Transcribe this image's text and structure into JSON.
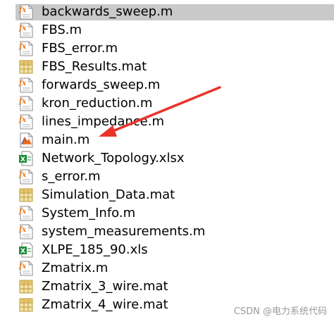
{
  "files": [
    {
      "name": "backwards_sweep.m",
      "icon": "matlab-function-icon",
      "selected": true
    },
    {
      "name": "FBS.m",
      "icon": "matlab-function-icon"
    },
    {
      "name": "FBS_error.m",
      "icon": "matlab-function-icon"
    },
    {
      "name": "FBS_Results.mat",
      "icon": "mat-data-file-icon"
    },
    {
      "name": "forwards_sweep.m",
      "icon": "matlab-function-icon"
    },
    {
      "name": "kron_reduction.m",
      "icon": "matlab-function-icon"
    },
    {
      "name": "lines_impedance.m",
      "icon": "matlab-function-icon"
    },
    {
      "name": "main.m",
      "icon": "matlab-script-icon"
    },
    {
      "name": "Network_Topology.xlsx",
      "icon": "excel-file-icon"
    },
    {
      "name": "s_error.m",
      "icon": "matlab-function-icon"
    },
    {
      "name": "Simulation_Data.mat",
      "icon": "mat-data-file-icon"
    },
    {
      "name": "System_Info.m",
      "icon": "matlab-function-icon"
    },
    {
      "name": "system_measurements.m",
      "icon": "matlab-function-icon"
    },
    {
      "name": "XLPE_185_90.xls",
      "icon": "excel-file-icon"
    },
    {
      "name": "Zmatrix.m",
      "icon": "matlab-function-icon"
    },
    {
      "name": "Zmatrix_3_wire.mat",
      "icon": "mat-data-file-icon"
    },
    {
      "name": "Zmatrix_4_wire.mat",
      "icon": "mat-data-file-icon"
    }
  ],
  "annotation": {
    "type": "red-arrow",
    "points_to": "main.m",
    "color": "#e8322a"
  },
  "watermark": "CSDN @电力系统代码",
  "colors": {
    "selection": "#c9c9c9",
    "function_icon": "#e07a1f",
    "mat_icon": "#d9b347",
    "excel_icon": "#1f8a3a"
  }
}
